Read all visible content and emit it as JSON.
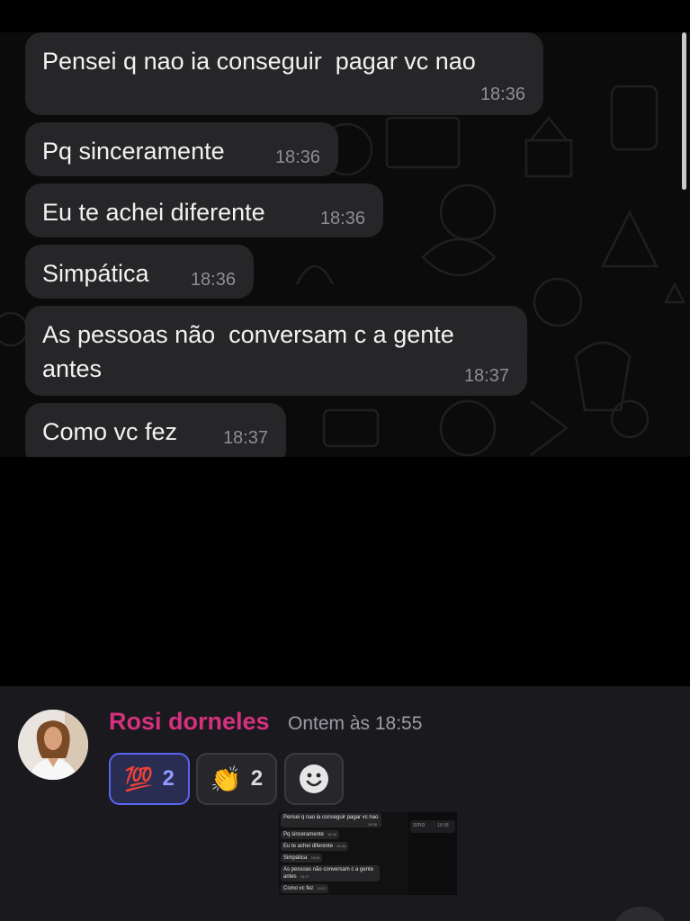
{
  "chat": {
    "messages": [
      {
        "text": "Pensei q nao ia conseguir  pagar vc nao",
        "time": "18:36"
      },
      {
        "text": "Pq sinceramente",
        "time": "18:36"
      },
      {
        "text": "Eu te achei diferente",
        "time": "18:36"
      },
      {
        "text": "Simpática",
        "time": "18:36"
      },
      {
        "text": "As pessoas não  conversam c a gente\nantes",
        "time": "18:37"
      },
      {
        "text": "Como vc fez",
        "time": "18:37"
      }
    ]
  },
  "post": {
    "author": "Rosi dorneles",
    "timestamp": "Ontem às 18:55",
    "reactions": [
      {
        "emoji": "💯",
        "count": "2",
        "active": true
      },
      {
        "emoji": "👏",
        "count": "2",
        "active": false
      }
    ],
    "add_reaction_icon": "smiley-face-icon",
    "thumbnail": {
      "messages": [
        {
          "text": "Pensei q nao ia conseguir  pagar vc nao",
          "time": "18:36"
        },
        {
          "text": "Pq sinceramente",
          "time": "18:36"
        },
        {
          "text": "Eu te achei diferente",
          "time": "18:36"
        },
        {
          "text": "Simpática",
          "time": "18:36"
        },
        {
          "text": "As pessoas não  conversam c a gente antes",
          "time": "18:37"
        },
        {
          "text": "Como vc fez",
          "time": "18:37"
        }
      ],
      "right_bubble_text": "smo",
      "right_bubble_time": "18:38"
    }
  },
  "colors": {
    "author": "#d6307f",
    "active_reaction_border": "#5865f2",
    "bubble_bg": "#262628"
  }
}
